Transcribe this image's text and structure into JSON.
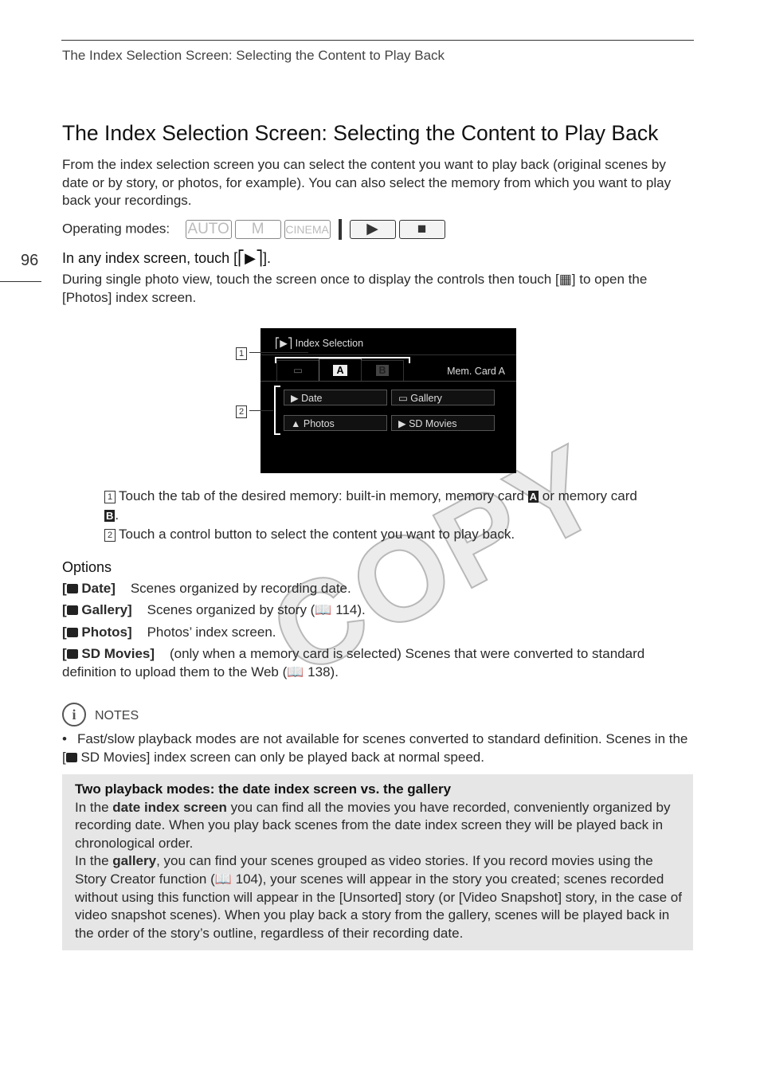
{
  "header": {
    "running_title": "The Index Selection Screen: Selecting the Content to Play Back",
    "page_number": "96"
  },
  "title": "The Index Selection Screen: Selecting the Content to Play Back",
  "intro": "From the index selection screen you can select the content you want to play back (original scenes by date or by story, or photos, for example). You can also select the memory from which you want to play back your recordings.",
  "operating_modes": {
    "label": "Operating modes:",
    "modes": [
      "AUTO",
      "M",
      "CINEMA"
    ],
    "playback_icons": [
      "movie-playback-icon",
      "photo-playback-icon"
    ]
  },
  "step": {
    "instruction": "In any index screen, touch [",
    "instruction_end": "].",
    "detail_a": "During single photo view, touch the screen once to display the controls then touch [",
    "detail_b": "] to open the [Photos] index screen."
  },
  "screen": {
    "title": "Index Selection",
    "tabs": [
      "built-in",
      "A",
      "B"
    ],
    "memory_label": "Mem. Card A",
    "buttons": [
      "Date",
      "Gallery",
      "Photos",
      "SD Movies"
    ],
    "callouts": [
      "1",
      "2"
    ]
  },
  "callouts": [
    {
      "num": "1",
      "text_a": "Touch the tab of the desired memory: built-in memory, memory card ",
      "badge_a": "A",
      "text_b": " or memory card ",
      "badge_b": "B",
      "text_c": "."
    },
    {
      "num": "2",
      "text": "Touch a control button to select the content you want to play back."
    }
  ],
  "options": {
    "heading": "Options",
    "items": [
      {
        "label": "Date]",
        "desc": "Scenes organized by recording date."
      },
      {
        "label": "Gallery]",
        "desc": "Scenes organized by story (",
        "ref": "114)."
      },
      {
        "label": "Photos]",
        "desc": "Photos’ index screen."
      },
      {
        "label": "SD Movies]",
        "desc": "(only when a memory card is selected) Scenes that were converted to standard",
        "desc2": "definition to upload them to the Web (",
        "ref": "138)."
      }
    ]
  },
  "notes": {
    "heading": "NOTES",
    "bullet_a": "Fast/slow playback modes are not available for scenes converted to standard definition. Scenes in the [",
    "bullet_b": " SD Movies] index screen can only be played back at normal speed."
  },
  "box": {
    "heading": "Two playback modes: the date index screen vs. the gallery",
    "p1a": "In the ",
    "p1b": "date index screen",
    "p1c": " you can find all the movies you have recorded, conveniently organized by recording date. When you play back scenes from the date index screen they will be played back in chronological order.",
    "p2a": "In the ",
    "p2b": "gallery",
    "p2c": ", you can find your scenes grouped as video stories. If you record movies using the Story Creator function (",
    "p2d": " 104), your scenes will appear in the story you created; scenes recorded without using this function will appear in the [Unsorted] story (or [Video Snapshot] story, in the case of video snapshot scenes). When you play back a story from the gallery, scenes will be played back in the order of the story’s outline, regardless of their recording date."
  },
  "watermark": "COPY"
}
